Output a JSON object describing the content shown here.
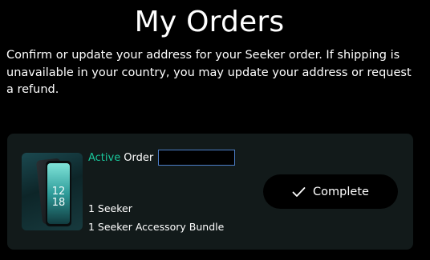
{
  "page": {
    "title": "My Orders",
    "intro": "Confirm or update your address for your Seeker order. If shipping is unavailable in your country, you may update your address or request a refund."
  },
  "order": {
    "status_label": "Active",
    "order_label": "Order",
    "order_input_value": "",
    "product_image_icon": "seeker-phone-image",
    "phone_time": "12\n18",
    "items": [
      "1 Seeker",
      "1 Seeker Accessory Bundle"
    ],
    "complete_button_label": "Complete",
    "complete_button_icon": "check-icon",
    "accent_color": "#19c59a"
  }
}
